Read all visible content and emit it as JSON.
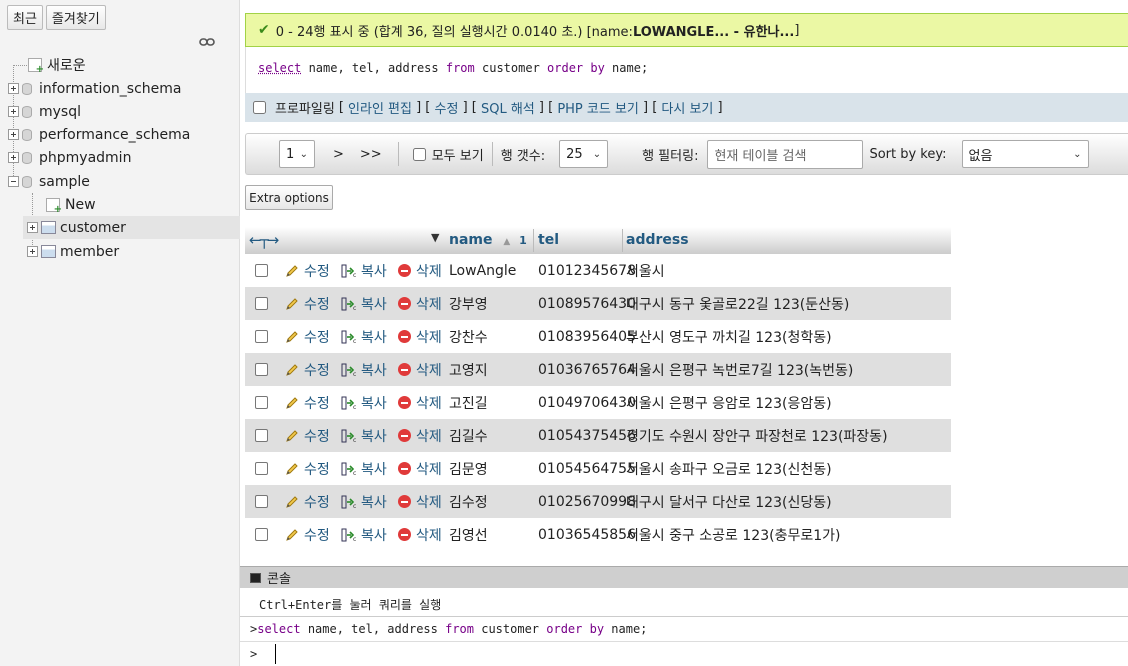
{
  "sidebar": {
    "recent_label": "최근",
    "favorites_label": "즐겨찾기",
    "tree": [
      {
        "label": "새로운",
        "kind": "new"
      },
      {
        "label": "information_schema",
        "kind": "db"
      },
      {
        "label": "mysql",
        "kind": "db"
      },
      {
        "label": "performance_schema",
        "kind": "db"
      },
      {
        "label": "phpmyadmin",
        "kind": "db"
      },
      {
        "label": "sample",
        "kind": "db",
        "expanded": true
      },
      {
        "label": "New",
        "kind": "new-table"
      },
      {
        "label": "customer",
        "kind": "table",
        "selected": true
      },
      {
        "label": "member",
        "kind": "table"
      }
    ]
  },
  "result": {
    "message_prefix": "0 - 24행 표시 중 (합계 36, 질의 실행시간 0.0140 초.) [name: ",
    "message_bold": "LOWANGLE... - 유한나...",
    "message_suffix": "]"
  },
  "query": {
    "kw_select": "select",
    "cols": " name, tel, address ",
    "kw_from": "from",
    "table": " customer ",
    "kw_order": "order",
    "kw_by": "by",
    "order_col": " name;"
  },
  "profbar": {
    "profiling_label": "프로파일링",
    "links": [
      "인라인 편집",
      "수정",
      "SQL 해석",
      "PHP 코드 보기",
      "다시 보기"
    ]
  },
  "navbar": {
    "page_value": "1",
    "next_label": ">",
    "last_label": ">>",
    "show_all_label": "모두 보기",
    "rows_label": "행 갯수:",
    "rows_value": "25",
    "filter_label": "행 필터링:",
    "filter_placeholder": "현재 테이블 검색",
    "sortby_label": "Sort by key:",
    "sortby_value": "없음"
  },
  "extra_options_label": "Extra options",
  "grid": {
    "columns": [
      "name",
      "tel",
      "address"
    ],
    "sort_indicator": "1",
    "action_labels": {
      "edit": "수정",
      "copy": "복사",
      "delete": "삭제"
    },
    "rows": [
      {
        "name": "LowAngle",
        "tel": "01012345678",
        "address": "서울시"
      },
      {
        "name": "강부영",
        "tel": "01089576430",
        "address": "대구시 동구 옻골로22길 123(둔산동)"
      },
      {
        "name": "강찬수",
        "tel": "01083956405",
        "address": "부산시 영도구 까치길 123(청학동)"
      },
      {
        "name": "고영지",
        "tel": "01036765764",
        "address": "서울시 은평구 녹번로7길 123(녹번동)"
      },
      {
        "name": "고진길",
        "tel": "01049706430",
        "address": "서울시 은평구 응암로 123(응암동)"
      },
      {
        "name": "김길수",
        "tel": "01054375456",
        "address": "경기도 수원시 장안구 파장천로 123(파장동)"
      },
      {
        "name": "김문영",
        "tel": "01054564755",
        "address": "서울시 송파구 오금로 123(신천동)"
      },
      {
        "name": "김수정",
        "tel": "01025670998",
        "address": "대구시 달서구 다산로 123(신당동)"
      },
      {
        "name": "김영선",
        "tel": "01036545856",
        "address": "서울시 중구 소공로 123(충무로1가)"
      }
    ]
  },
  "console": {
    "title": "콘솔",
    "hint": "Ctrl+Enter를 눌러 쿼리를 실행",
    "history_prompt": ">",
    "prompt": ">"
  }
}
